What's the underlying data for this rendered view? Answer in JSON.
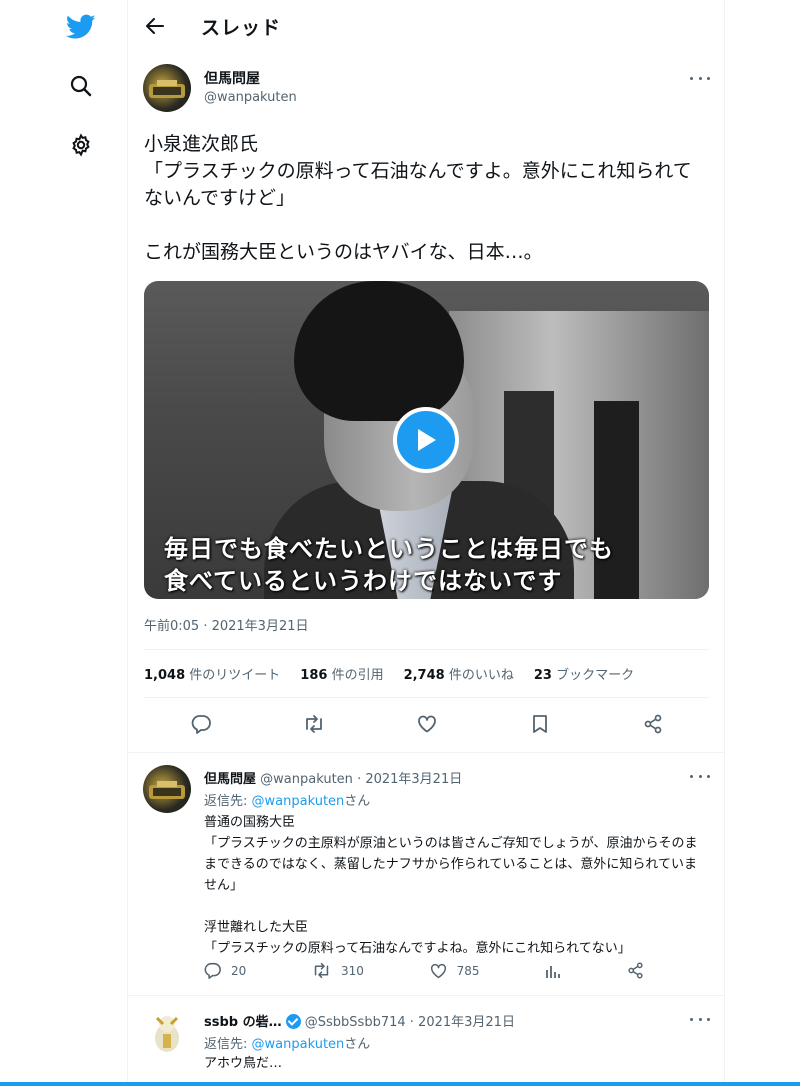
{
  "nav": {
    "logo_icon": "twitter-bird-icon",
    "search_icon": "search-icon",
    "settings_icon": "gear-icon"
  },
  "header": {
    "title": "スレッド",
    "back_icon": "back-arrow-icon"
  },
  "main_tweet": {
    "name": "但馬問屋",
    "handle": "@wanpakuten",
    "text": "小泉進次郎氏\n「プラスチックの原料って石油なんですよ。意外にこれ知られてないんですけど」\n\nこれが国務大臣というのはヤバイな、日本…。",
    "video_subtitle_1": "毎日でも食べたいということは毎日でも",
    "video_subtitle_2": "食べているというわけではないです",
    "timestamp": "午前0:05 · 2021年3月21日",
    "stats": {
      "retweets_count": "1,048",
      "retweets_label": "件のリツイート",
      "quotes_count": "186",
      "quotes_label": "件の引用",
      "likes_count": "2,748",
      "likes_label": "件のいいね",
      "bookmarks_count": "23",
      "bookmarks_label": "ブックマーク"
    }
  },
  "replies": [
    {
      "name": "但馬問屋",
      "handle": "@wanpakuten",
      "date": "· 2021年3月21日",
      "reply_to_prefix": "返信先: ",
      "reply_to_handle": "@wanpakuten",
      "reply_to_suffix": "さん",
      "text": "普通の国務大臣\n「プラスチックの主原料が原油というのは皆さんご存知でしょうが、原油からそのままできるのではなく、蒸留したナフサから作られていることは、意外に知られていません」\n\n浮世離れした大臣\n「プラスチックの原料って石油なんですよね。意外にこれ知られてない」",
      "replies": "20",
      "retweets": "310",
      "likes": "785"
    },
    {
      "name": "ssbb の砦…",
      "handle": "@SsbbSsbb714",
      "date": "· 2021年3月21日",
      "reply_to_prefix": "返信先: ",
      "reply_to_handle": "@wanpakuten",
      "reply_to_suffix": "さん",
      "text": "アホウ鳥だ…"
    }
  ],
  "colors": {
    "accent": "#1d9bf0",
    "text": "#0f1419",
    "secondary": "#536471",
    "border": "#eff3f4"
  }
}
